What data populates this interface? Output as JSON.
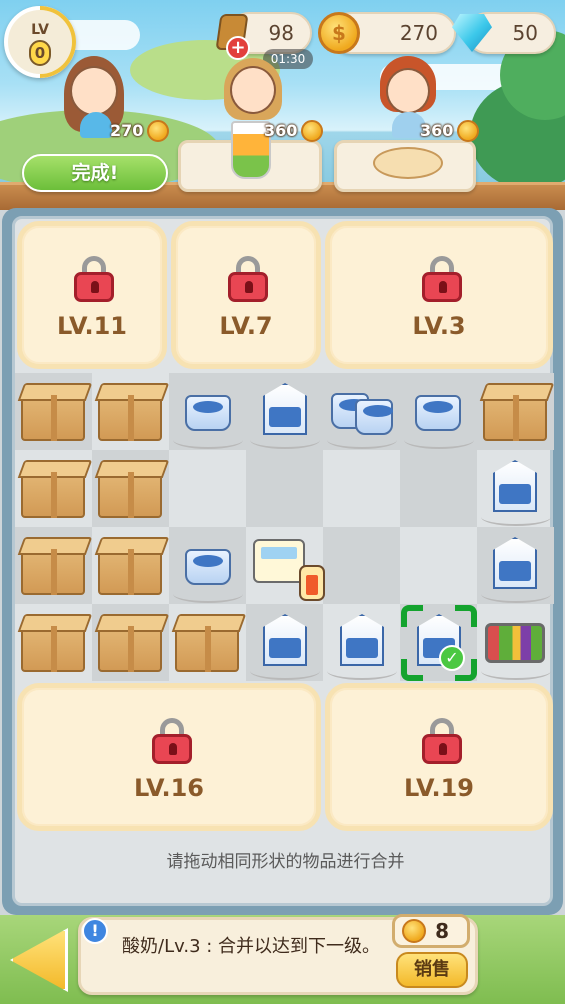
{
  "header": {
    "level_label": "LV",
    "level_value": "0",
    "energy": "98",
    "energy_timer": "01:30",
    "coins": "270",
    "gems": "50",
    "plus_label": "+",
    "coin_glyph": "$"
  },
  "customers": [
    {
      "reward": "270",
      "action_label": "完成!",
      "order_icon": "none"
    },
    {
      "reward": "360",
      "order_icon": "fruit-tea-cup-icon"
    },
    {
      "reward": "360",
      "order_icon": "dough-rolling-pin-icon"
    }
  ],
  "locked_zones": [
    {
      "label": "LV.11"
    },
    {
      "label": "LV.7"
    },
    {
      "label": "LV.3"
    },
    {
      "label": "LV.16"
    },
    {
      "label": "LV.19"
    }
  ],
  "board": {
    "hint": "请拖动相同形状的物品进行合并",
    "selected_item": "milk-carton"
  },
  "bottom": {
    "info_icon": "!",
    "item_info": "酸奶/Lv.3 : 合并以达到下一级。",
    "sell_price": "8",
    "sell_label": "销售"
  },
  "colors": {
    "selection": "#14a32e",
    "lock": "#e94653",
    "accent": "#f3b92a",
    "done_button": "#6cbf3a"
  }
}
